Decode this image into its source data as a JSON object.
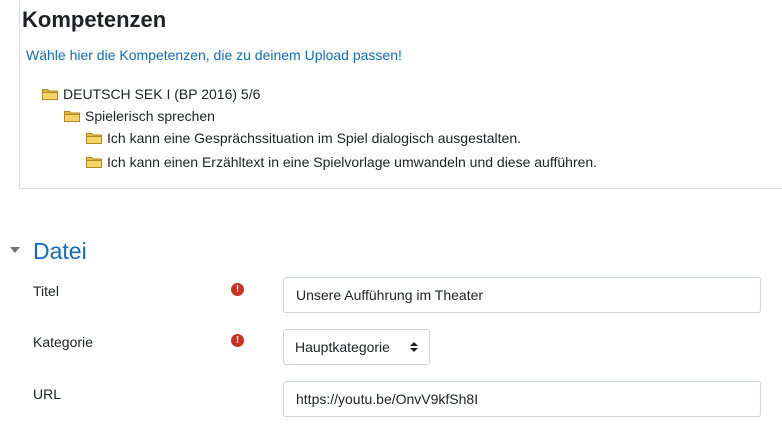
{
  "kompetenzen": {
    "title": "Kompetenzen",
    "hint": "Wähle hier die Kompetenzen, die zu deinem Upload passen!",
    "tree": [
      {
        "label": "DEUTSCH SEK I (BP 2016) 5/6",
        "level": 1
      },
      {
        "label": "Spielerisch sprechen",
        "level": 2
      },
      {
        "label": "Ich kann eine Gesprächssituation im Spiel dialogisch ausgestalten.",
        "level": 3
      },
      {
        "label": "Ich kann einen Erzähltext in eine Spielvorlage umwandeln und diese aufführen.",
        "level": 3
      }
    ]
  },
  "datei": {
    "section_title": "Datei",
    "titel": {
      "label": "Titel",
      "value": "Unsere Aufführung im Theater",
      "required": true
    },
    "kategorie": {
      "label": "Kategorie",
      "value": "Hauptkategorie",
      "required": true
    },
    "url": {
      "label": "URL",
      "value": "https://youtu.be/OnvV9kfSh8I"
    }
  },
  "colors": {
    "link": "#0f6cbf",
    "required": "#ca3120",
    "folder": "#e8b93f"
  },
  "icons": {
    "folder": "folder-icon",
    "required": "exclamation-circle-icon",
    "collapse": "caret-down-icon",
    "select": "updown-arrows-icon"
  }
}
